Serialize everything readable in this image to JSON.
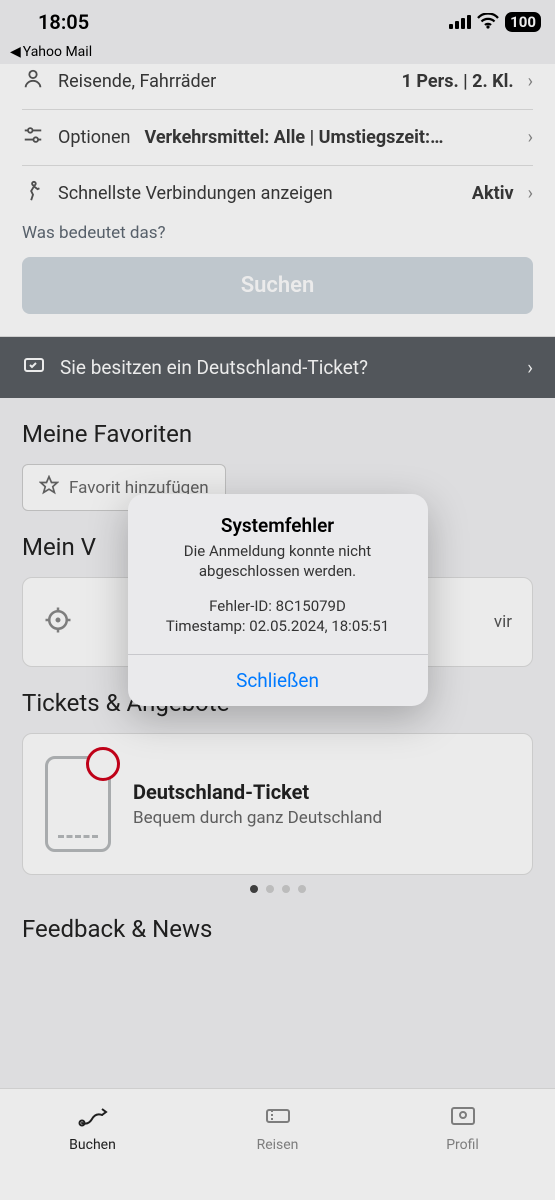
{
  "statusbar": {
    "time": "18:05",
    "back": "Yahoo Mail",
    "battery": "100"
  },
  "form": {
    "travelers": {
      "label": "Reisende, Fahrräder",
      "value": "1 Pers. | 2. Kl."
    },
    "options": {
      "label": "Optionen",
      "value": "Verkehrsmittel: Alle | Umstiegszeit:…"
    },
    "fastest": {
      "label": "Schnellste Verbindungen anzeigen",
      "value": "Aktiv"
    },
    "hint": "Was bedeutet das?",
    "search": "Suchen"
  },
  "banner": {
    "text": "Sie besitzen ein Deutschland-Ticket?"
  },
  "favorites": {
    "heading": "Meine Favoriten",
    "add": "Favorit hinzufügen"
  },
  "trip": {
    "heading_partial": "Mein V",
    "hint_tail": "vir"
  },
  "offers": {
    "heading": "Tickets & Angebote",
    "card": {
      "title": "Deutschland-Ticket",
      "subtitle": "Bequem durch ganz Deutschland"
    }
  },
  "feedback": {
    "heading": "Feedback & News"
  },
  "tabs": {
    "buchen": "Buchen",
    "reisen": "Reisen",
    "profil": "Profil"
  },
  "alert": {
    "title": "Systemfehler",
    "message": "Die Anmeldung konnte nicht abgeschlossen werden.",
    "error_id_label": "Fehler-ID:",
    "error_id": "8C15079D",
    "timestamp_label": "Timestamp:",
    "timestamp": "02.05.2024, 18:05:51",
    "close": "Schließen"
  }
}
